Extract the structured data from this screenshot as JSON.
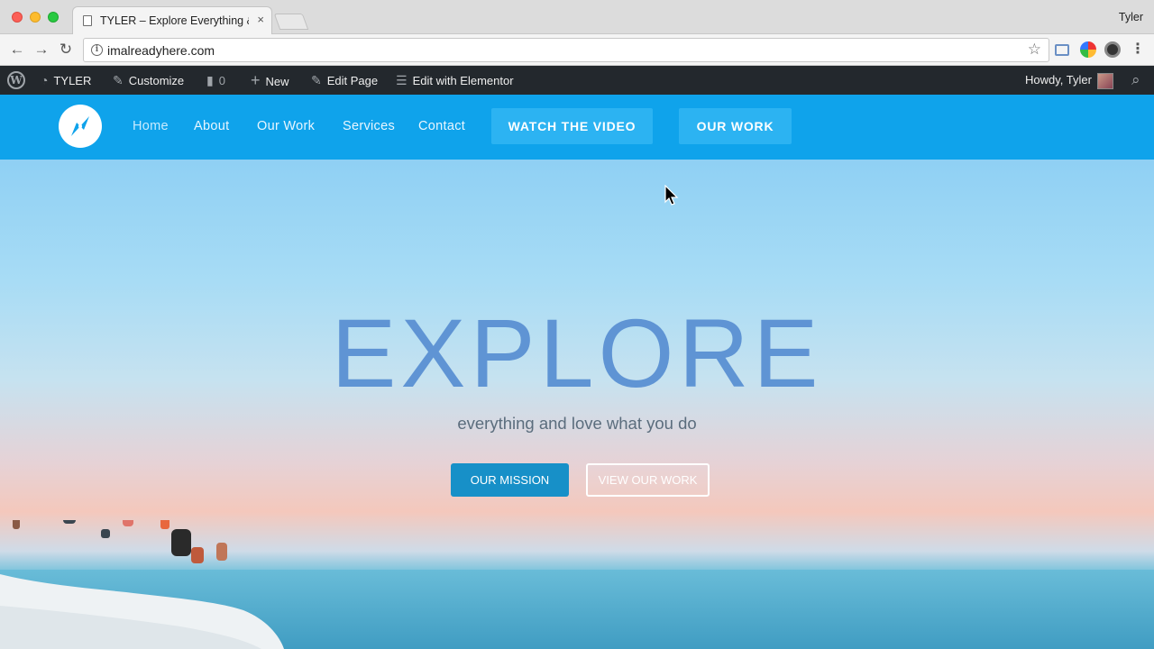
{
  "browser": {
    "tab_title": "TYLER – Explore Everything & Love",
    "tab_close": "×",
    "profile_name": "Tyler",
    "url": "imalreadyhere.com",
    "nav": {
      "back": "←",
      "forward": "→",
      "reload": "↻"
    },
    "star": "☆",
    "menu": "⋮",
    "info": "i"
  },
  "adminbar": {
    "site_name": "TYLER",
    "customize": "Customize",
    "comments_count": "0",
    "new": "New",
    "edit_page": "Edit Page",
    "edit_elementor": "Edit with Elementor",
    "howdy": "Howdy, Tyler",
    "wp_logo": "W",
    "icons": {
      "dashboard": "◔",
      "customize": "✎",
      "comments": "▮",
      "new": "+",
      "edit": "✎",
      "elementor": "☰",
      "search": "⌕"
    }
  },
  "site_nav": {
    "links": [
      "Home",
      "About",
      "Our Work",
      "Services",
      "Contact"
    ],
    "watch_video": "WATCH THE VIDEO",
    "our_work": "OUR WORK"
  },
  "hero": {
    "title": "EXPLORE",
    "subtitle": "everything and love what you do",
    "btn_mission": "OUR MISSION",
    "btn_view_work": "VIEW OUR WORK"
  },
  "colors": {
    "header_blue": "#0fa3eb",
    "header_button": "#2cb3f2",
    "hero_title": "#5f94d4",
    "mission_button": "#1790c8",
    "adminbar": "#23282d"
  }
}
